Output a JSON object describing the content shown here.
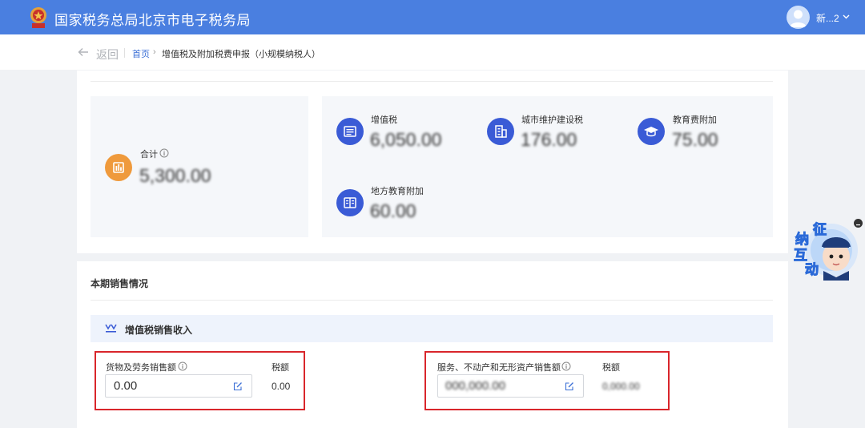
{
  "header": {
    "site_title": "国家税务总局北京市电子税务局",
    "user_name": "新...2",
    "logo_icon": "tax-emblem-icon",
    "brand_color": "#4a7fe0"
  },
  "breadcrumb": {
    "back_label": "返回",
    "home": "首页",
    "separator": "›",
    "current": "增值税及附加税费申报（小规模纳税人）"
  },
  "summary": {
    "total": {
      "label": "合计",
      "value": "5,300.00",
      "icon": "bar-chart-icon"
    },
    "taxes": [
      {
        "label": "增值税",
        "value": "6,050.00",
        "icon": "tax-receipt-icon"
      },
      {
        "label": "城市维护建设税",
        "value": "176.00",
        "icon": "building-icon"
      },
      {
        "label": "教育费附加",
        "value": "75.00",
        "icon": "graduation-cap-icon"
      },
      {
        "label": "地方教育附加",
        "value": "60.00",
        "icon": "book-icon"
      }
    ]
  },
  "sales": {
    "section_title": "本期销售情况",
    "vat_title": "增值税销售收入",
    "goods": {
      "label": "货物及劳务销售额",
      "amount": "0.00",
      "tax_label": "税额",
      "tax_value": "0.00"
    },
    "services": {
      "label": "服务、不动产和无形资产销售额",
      "amount": "000,000.00",
      "tax_label": "税额",
      "tax_value": "0,000.00"
    }
  },
  "floating_widget": {
    "chars": [
      "征",
      "纳",
      "互",
      "动"
    ]
  }
}
